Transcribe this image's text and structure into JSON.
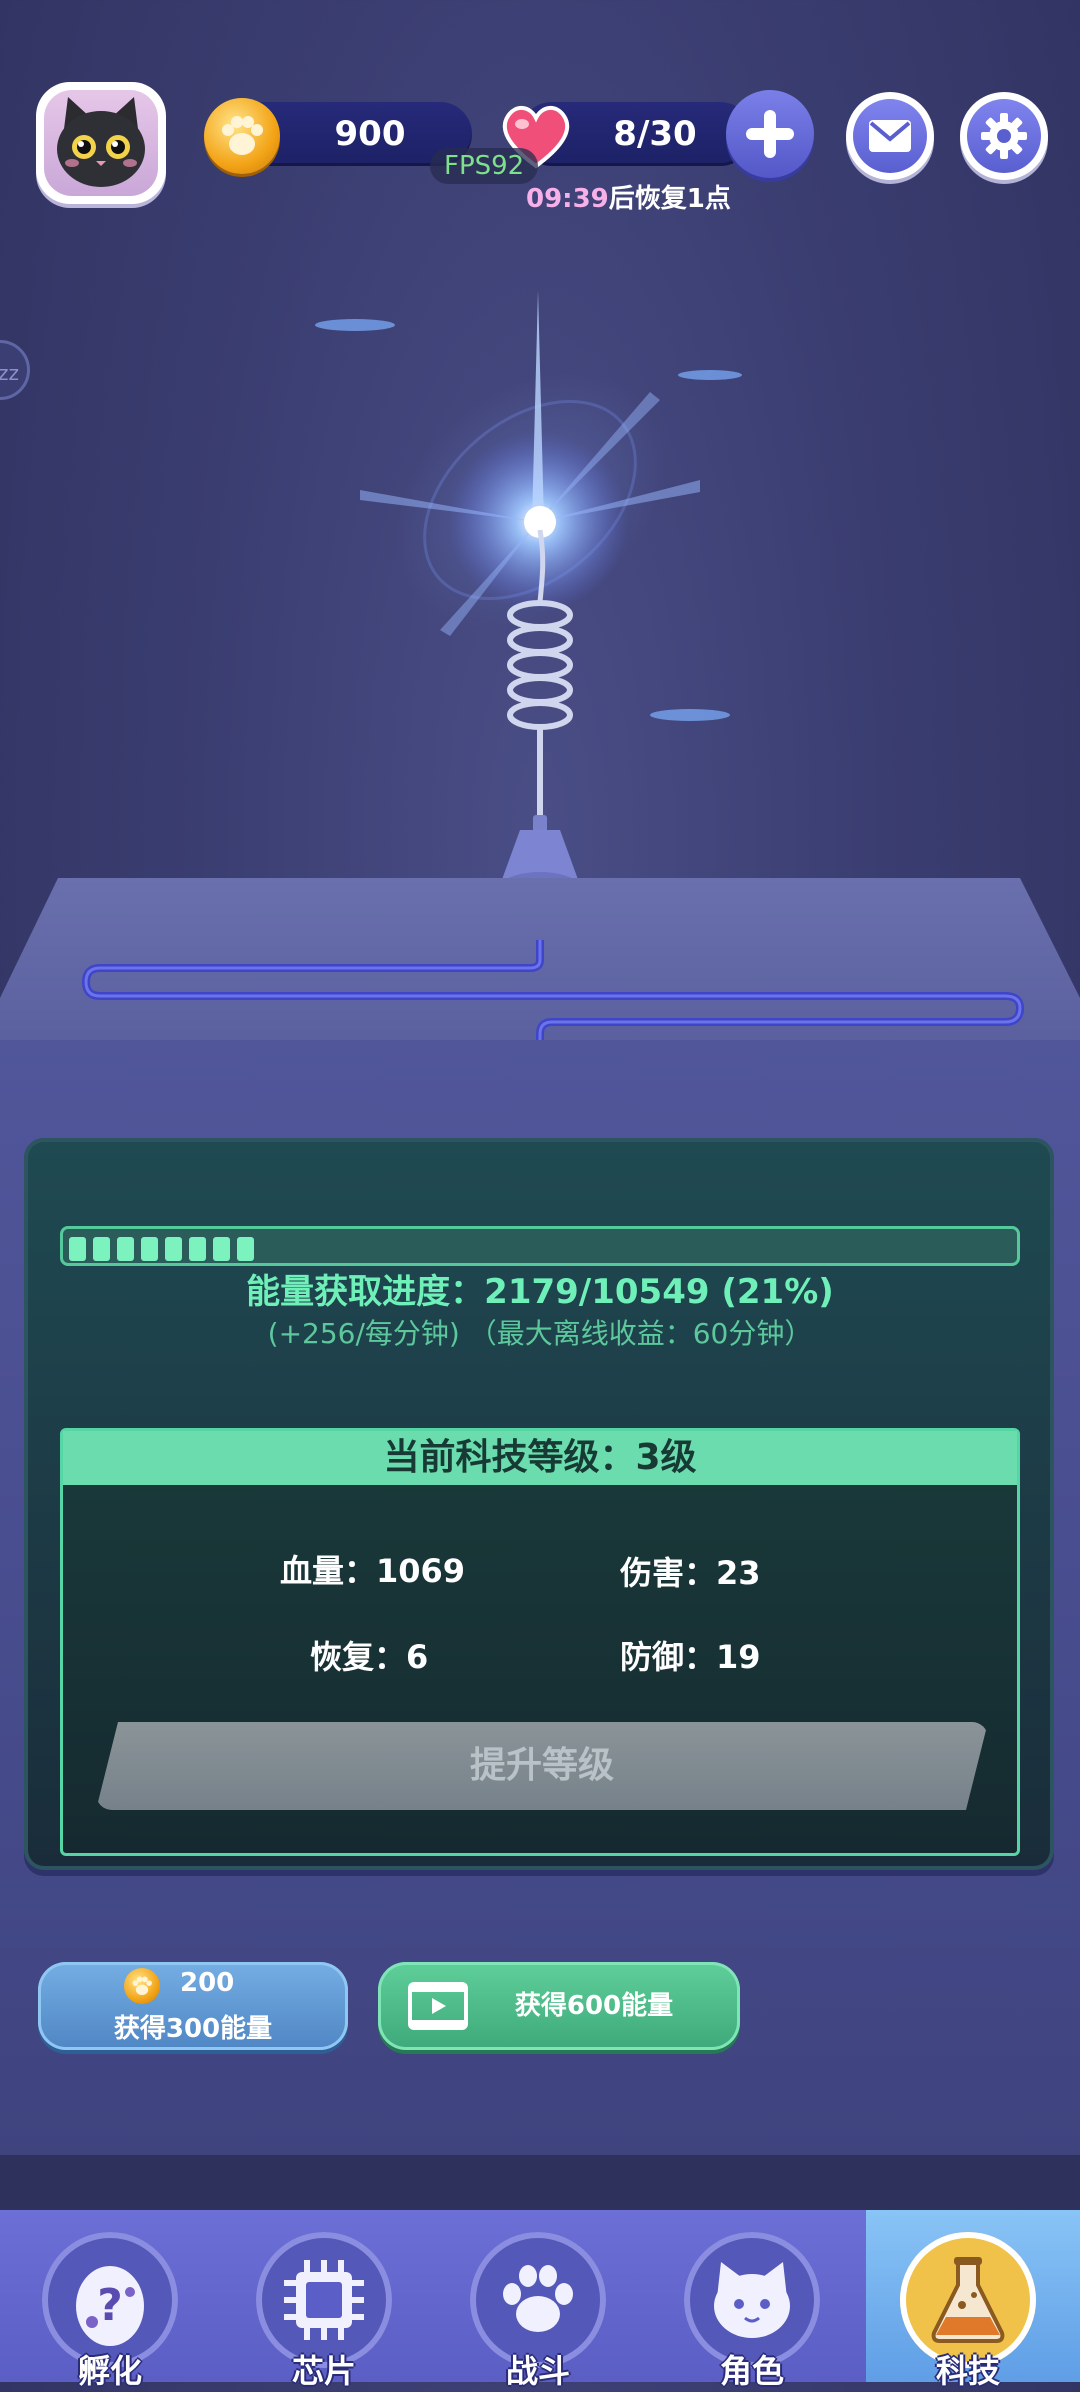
{
  "hud": {
    "coins": "900",
    "hearts": "8/30",
    "fps": "FPS92",
    "recover_time": "09:39",
    "recover_suffix": "后恢复1点"
  },
  "icons": {
    "avatar": "black-cat-avatar-icon",
    "coin": "paw-coin-icon",
    "heart": "heart-icon",
    "plus": "plus-icon",
    "mail": "mail-icon",
    "settings": "gear-icon"
  },
  "energy": {
    "progress_percent": 21,
    "progress_text": "能量获取进度：2179/10549  (21%)",
    "rate_text": "(+256/每分钟) （最大离线收益：60分钟）"
  },
  "tech": {
    "level_title": "当前科技等级：3级",
    "hp": "血量：1069",
    "damage": "伤害：23",
    "regen": "恢复：6",
    "defense": "防御：19",
    "upgrade_label": "提升等级"
  },
  "actions": {
    "buy_cost": "200",
    "buy_label": "获得300能量",
    "video_label": "获得600能量"
  },
  "nav": {
    "items": [
      "孵化",
      "芯片",
      "战斗",
      "角色",
      "科技"
    ],
    "active": "科技"
  },
  "colors": {
    "accent_green": "#6ff0b8",
    "nav_active": "#5f9ee6"
  }
}
